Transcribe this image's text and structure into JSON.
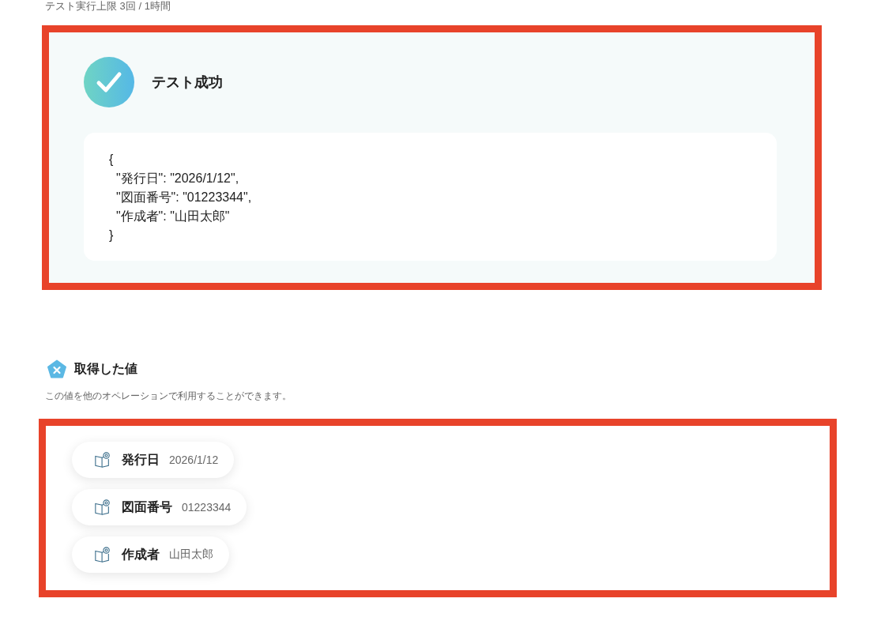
{
  "header_note": "テスト実行上限 3回 / 1時間",
  "test_result": {
    "succeeded": true,
    "title": "テスト成功",
    "code_lines": [
      "{",
      "  \"発行日\": \"2026/1/12\",",
      "  \"図面番号\": \"01223344\",",
      "  \"作成者\": \"山田太郎\"",
      "}"
    ]
  },
  "values_section": {
    "title": "取得した値",
    "description": "この値を他のオペレーションで利用することができます。",
    "items": [
      {
        "label": "発行日",
        "value": "2026/1/12"
      },
      {
        "label": "図面番号",
        "value": "01223344"
      },
      {
        "label": "作成者",
        "value": "山田太郎"
      }
    ]
  }
}
